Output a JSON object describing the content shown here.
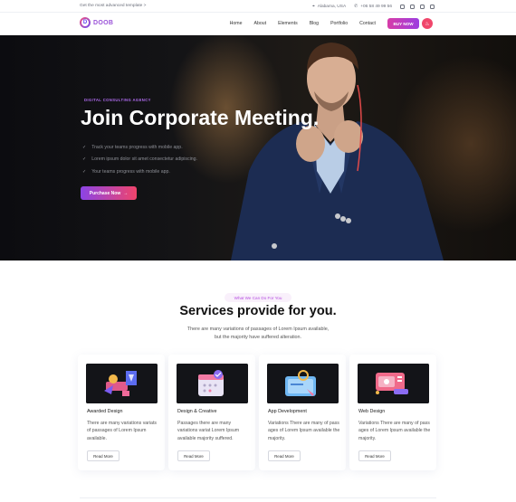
{
  "topbar": {
    "promo": "Get the most advanced template  >",
    "location": "Alabama, USA",
    "phone": "+06 58 49 99 56",
    "social": [
      "facebook-icon",
      "twitter-icon",
      "instagram-icon",
      "linkedin-icon"
    ]
  },
  "nav": {
    "logo_letter": "D",
    "logo_text": "DOOB",
    "menu": [
      "Home",
      "About",
      "Elements",
      "Blog",
      "Portfolio",
      "Contact"
    ],
    "buy_label": "BUY NOW",
    "circle_icon": "flame-icon"
  },
  "hero": {
    "tag": "DIGITAL CONSULTING AGENCY",
    "title": "Join Corporate Meeting.",
    "checks": [
      "Track your teams progress with mobile app.",
      "Lorem ipsum dolor sit amet consectetur adipiscing.",
      "Your teams progress with mobile app."
    ],
    "cta": "Purchase Now"
  },
  "services": {
    "tag": "What We Can Do For You",
    "title": "Services provide for you.",
    "desc_line1": "There are many variations of passages of Lorem Ipsum available,",
    "desc_line2": "but the majority have suffered alteration.",
    "cards": [
      {
        "name": "Awarded Design",
        "text": "There are many variations variats of passages of Lorem Ipsum available.",
        "more": "Read More"
      },
      {
        "name": "Design & Creative",
        "text": "Passages there are many variations variat Lorem Ipsum available majority suffered.",
        "more": "Read More"
      },
      {
        "name": "App Development",
        "text": "Variations There are many of pass ages of Lorem Ipsum available the majority.",
        "more": "Read More"
      },
      {
        "name": "Web Design",
        "text": "Variations There are many of pass ages of Lorem Ipsum available the majority.",
        "more": "Read More"
      }
    ]
  }
}
